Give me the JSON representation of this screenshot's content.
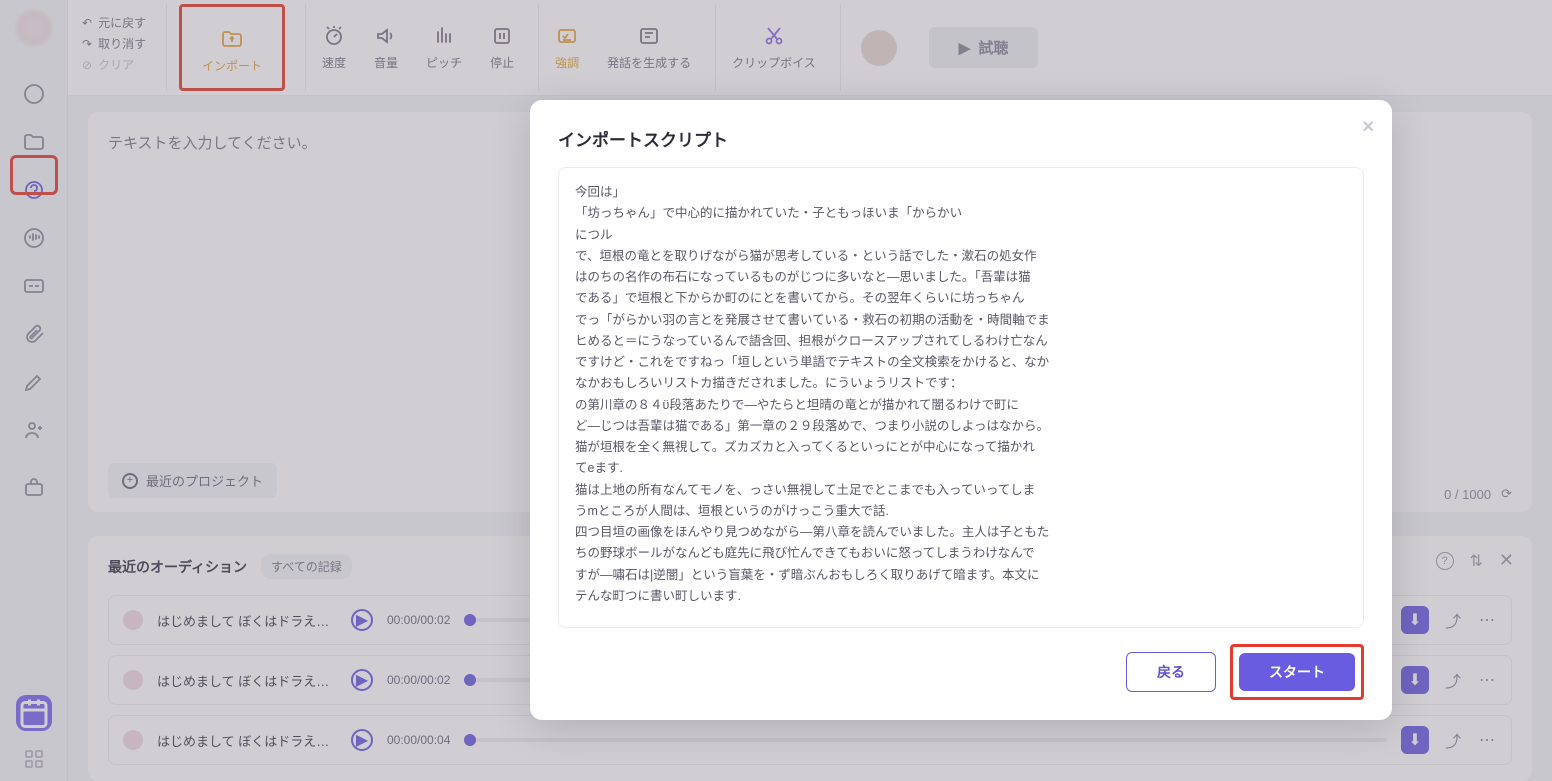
{
  "toolbar": {
    "undo": "元に戻す",
    "redo": "取り消す",
    "clear": "クリア",
    "import": "インポート",
    "speed": "速度",
    "volume": "音量",
    "pitch": "ピッチ",
    "pause": "停止",
    "emphasis": "強調",
    "generate": "発話を生成する",
    "clipvoice": "クリップボイス",
    "preview": "試聴"
  },
  "editor": {
    "placeholder": "テキストを入力してください。",
    "recent_project": "最近のプロジェクト",
    "counter": "0 / 1000"
  },
  "audition": {
    "title": "最近のオーディション",
    "all_tab": "すべての記録",
    "rows": [
      {
        "text": "はじめまして ぼくはドラえも...",
        "time": "00:00/00:02"
      },
      {
        "text": "はじめまして ぼくはドラえも...",
        "time": "00:00/00:02"
      },
      {
        "text": "はじめまして ぼくはドラえも...",
        "time": "00:00/00:04"
      }
    ]
  },
  "modal": {
    "title": "インポートスクリプト",
    "body": "今回は」\n「坊っちゃん」で中心的に描かれていた・子ともっほいま「からかい\nにつル\nで、垣根の竜とを取りげながら猫が思考している・という話でした・漱石の処女作\nはのちの名作の布石になっているものがじつに多いなと―思いました。「吾輩は猫\nである」で垣根と下からか町のにとを書いてから。その翌年くらいに坊っちゃん\nでっ「がらかい羽の言とを発展させて書いている・救石の初期の活動を・時間軸でま\nヒめると＝にうなっているんで語含回、担根がクロースアップされてしるわけ亡なん\nですけど・これをですねっ「垣しという単語でテキストの全文検索をかけると、なか\nなかおもしろいリストカ描きだされました。にういょうリストです：\nの第川章の８４ϋ段落あたりで―やたらと坦晴の竜とが描かれて闇るわけで町に\nど―じつは吾輩は猫である」第一章の２９段落めで、つまり小説のしよっはなから。\n猫が垣根を全く無視して。ズカズカと入ってくるといっにとが中心になって描かれ\nてeます.\n猫は上地の所有なんてモノを、っさい無視して土足でとこまでも入っていってしま\nうmところが人間は、垣根というのがけっこう重大で話.\n四つ目垣の画像をほんやり見つめながら―第八章を読んでいました。主人は子ともた\nちの野球ボールがなんども庭先に飛び忙んできてもおいに怒ってしまうわけなんで\nすが―嘯石は|逆闇」という盲葉を・ず暗ぶんおもしろく取りあげて暗ます。本文に\nテんな町つに書い町しいます.",
    "back": "戻る",
    "start": "スタート"
  }
}
